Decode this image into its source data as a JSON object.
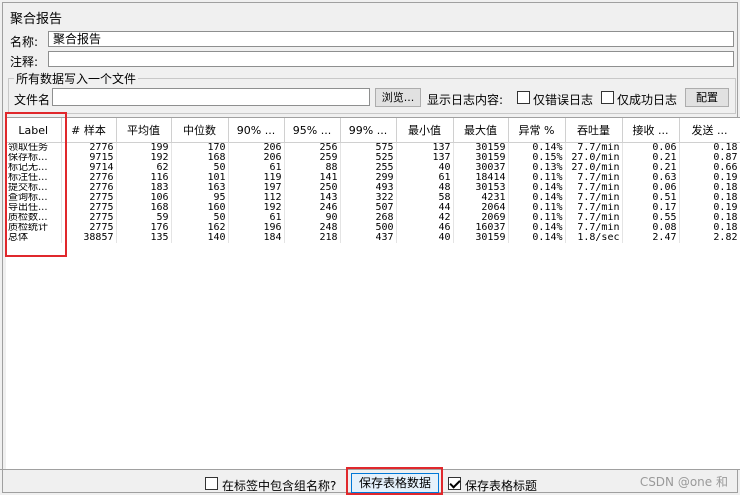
{
  "header": {
    "title": "聚合报告"
  },
  "form": {
    "name_label": "名称:",
    "name_value": "聚合报告",
    "comment_label": "注释:",
    "comment_value": ""
  },
  "file_group": {
    "title": "所有数据写入一个文件",
    "filename_label": "文件名",
    "filename_value": "",
    "browse_label": "浏览...",
    "log_content_label": "显示日志内容:",
    "errors_only_label": "仅错误日志",
    "success_only_label": "仅成功日志",
    "configure_label": "配置"
  },
  "table": {
    "columns": [
      "Label",
      "# 样本",
      "平均值",
      "中位数",
      "90% ...",
      "95% ...",
      "99% ...",
      "最小值",
      "最大值",
      "异常 %",
      "吞吐量",
      "接收 ...",
      "发送 ..."
    ],
    "rows": [
      [
        "领取任务",
        "2776",
        "199",
        "170",
        "206",
        "256",
        "575",
        "137",
        "30159",
        "0.14%",
        "7.7/min",
        "0.06",
        "0.18"
      ],
      [
        "保存标...",
        "9715",
        "192",
        "168",
        "206",
        "259",
        "525",
        "137",
        "30159",
        "0.15%",
        "27.0/min",
        "0.21",
        "0.87"
      ],
      [
        "标记无...",
        "9714",
        "62",
        "50",
        "61",
        "88",
        "255",
        "40",
        "30037",
        "0.13%",
        "27.0/min",
        "0.21",
        "0.66"
      ],
      [
        "标注任...",
        "2776",
        "116",
        "101",
        "119",
        "141",
        "299",
        "61",
        "18414",
        "0.11%",
        "7.7/min",
        "0.63",
        "0.19"
      ],
      [
        "提交标...",
        "2776",
        "183",
        "163",
        "197",
        "250",
        "493",
        "48",
        "30153",
        "0.14%",
        "7.7/min",
        "0.06",
        "0.18"
      ],
      [
        "查询标...",
        "2775",
        "106",
        "95",
        "112",
        "143",
        "322",
        "58",
        "4231",
        "0.14%",
        "7.7/min",
        "0.51",
        "0.18"
      ],
      [
        "导出任...",
        "2775",
        "168",
        "160",
        "192",
        "246",
        "507",
        "44",
        "2064",
        "0.11%",
        "7.7/min",
        "0.17",
        "0.19"
      ],
      [
        "质检数...",
        "2775",
        "59",
        "50",
        "61",
        "90",
        "268",
        "42",
        "2069",
        "0.11%",
        "7.7/min",
        "0.55",
        "0.18"
      ],
      [
        "质检统计",
        "2775",
        "176",
        "162",
        "196",
        "248",
        "500",
        "46",
        "16037",
        "0.14%",
        "7.7/min",
        "0.08",
        "0.18"
      ],
      [
        "总体",
        "38857",
        "135",
        "140",
        "184",
        "218",
        "437",
        "40",
        "30159",
        "0.14%",
        "1.8/sec",
        "2.47",
        "2.82"
      ]
    ]
  },
  "footer": {
    "include_group_label": "在标签中包含组名称?",
    "save_table_label": "保存表格数据",
    "save_header_label": "保存表格标题"
  },
  "watermark": "CSDN @one 和"
}
